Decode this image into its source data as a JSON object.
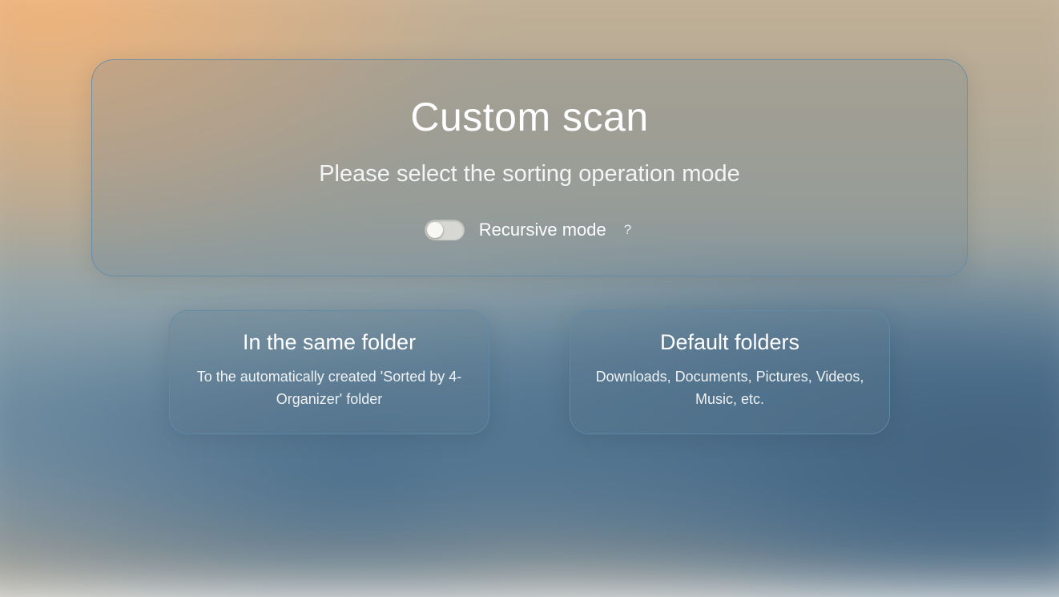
{
  "header": {
    "title": "Custom scan",
    "subtitle": "Please select the sorting operation mode"
  },
  "toggle": {
    "label": "Recursive mode",
    "help": "?",
    "on": false
  },
  "options": [
    {
      "title": "In the same folder",
      "desc": "To the automatically created 'Sorted by 4-Organizer' folder"
    },
    {
      "title": "Default folders",
      "desc": "Downloads, Documents, Pictures, Videos, Music, etc."
    }
  ]
}
